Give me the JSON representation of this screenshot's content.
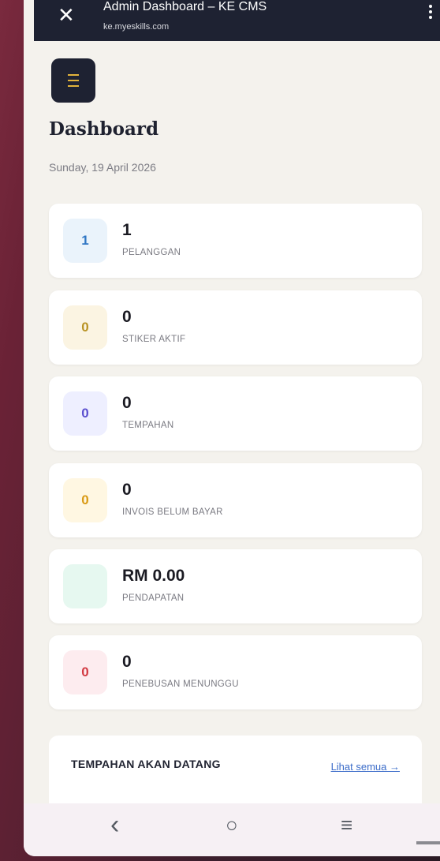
{
  "browser": {
    "title": "Admin Dashboard – KE CMS",
    "url": "ke.myeskills.com",
    "close_icon": "✕"
  },
  "page": {
    "title": "Dashboard",
    "date": "Sunday, 19 April 2026"
  },
  "stats": [
    {
      "icon_text": "1",
      "value": "1",
      "label": "PELANGGAN",
      "icon_color": "#2f76c4",
      "icon_bg": "#eaf3fb"
    },
    {
      "icon_text": "0",
      "value": "0",
      "label": "STIKER AKTIF",
      "icon_color": "#b99324",
      "icon_bg": "#fbf4e2"
    },
    {
      "icon_text": "0",
      "value": "0",
      "label": "TEMPAHAN",
      "icon_color": "#5b4fcf",
      "icon_bg": "#eeefff"
    },
    {
      "icon_text": "0",
      "value": "0",
      "label": "INVOIS BELUM BAYAR",
      "icon_color": "#d99a15",
      "icon_bg": "#fff7e2"
    },
    {
      "icon_text": "",
      "value": "RM 0.00",
      "label": "PENDAPATAN",
      "icon_color": "#3aa77a",
      "icon_bg": "#e6f8f0"
    },
    {
      "icon_text": "0",
      "value": "0",
      "label": "PENEBUSAN MENUNGGU",
      "icon_color": "#d23a42",
      "icon_bg": "#fdecef"
    }
  ],
  "upcoming": {
    "title": "TEMPAHAN AKAN DATANG",
    "link": "Lihat semua →"
  },
  "nav": {
    "back": "‹",
    "home": "○",
    "recents": "≡"
  }
}
